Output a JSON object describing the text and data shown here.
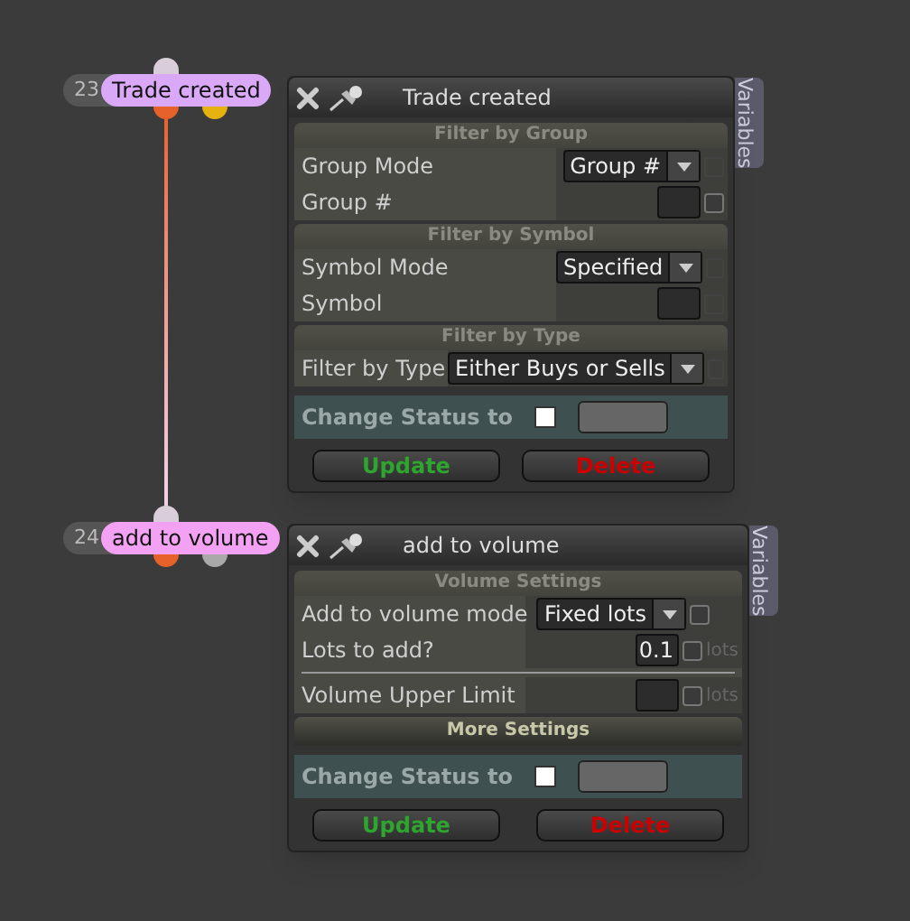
{
  "nodes": [
    {
      "number": "23",
      "label": "Trade created",
      "color": "#d9a9f7",
      "pins": [
        {
          "color": "#e7612a"
        },
        {
          "color": "#e5b20f"
        }
      ],
      "panel": {
        "title": "Trade created",
        "tab": "Variables",
        "sections": [
          {
            "title": "Filter by Group",
            "rows": [
              {
                "kind": "select",
                "label": "Group Mode",
                "value": "Group #",
                "check_disabled": true
              },
              {
                "kind": "input",
                "label": "Group #",
                "value": "",
                "check_disabled": false
              }
            ]
          },
          {
            "title": "Filter by Symbol",
            "rows": [
              {
                "kind": "select",
                "label": "Symbol Mode",
                "value": "Specified",
                "check_disabled": true
              },
              {
                "kind": "input",
                "label": "Symbol",
                "value": "",
                "check_disabled": true
              }
            ]
          },
          {
            "title": "Filter by Type",
            "rows": [
              {
                "kind": "select",
                "label": "Filter by Type",
                "value": "Either Buys or Sells",
                "check_disabled": true
              }
            ]
          }
        ],
        "status": {
          "label": "Change Status to",
          "checked": false
        },
        "buttons": [
          {
            "label": "Update",
            "kind": "update"
          },
          {
            "label": "Delete",
            "kind": "delete"
          }
        ]
      }
    },
    {
      "number": "24",
      "label": "add to volume",
      "color": "#f3a2f3",
      "pins": [
        {
          "color": "#e7612a"
        },
        {
          "color": "#a9a9a9"
        }
      ],
      "panel": {
        "title": "add to volume",
        "tab": "Variables",
        "sections": [
          {
            "title": "Volume Settings",
            "rows": [
              {
                "kind": "select",
                "label": "Add to volume mode",
                "value": "Fixed lots",
                "check_disabled": false
              },
              {
                "kind": "input",
                "label": "Lots to add?",
                "value": "0.1",
                "check_disabled": false,
                "unit": "lots"
              },
              {
                "kind": "rule"
              },
              {
                "kind": "input",
                "label": "Volume Upper Limit",
                "value": "",
                "check_disabled": false,
                "unit": "lots"
              }
            ]
          },
          {
            "title": "More Settings"
          }
        ],
        "status": {
          "label": "Change Status to",
          "checked": false
        },
        "buttons": [
          {
            "label": "Update",
            "kind": "update"
          },
          {
            "label": "Delete",
            "kind": "delete"
          }
        ]
      }
    }
  ]
}
